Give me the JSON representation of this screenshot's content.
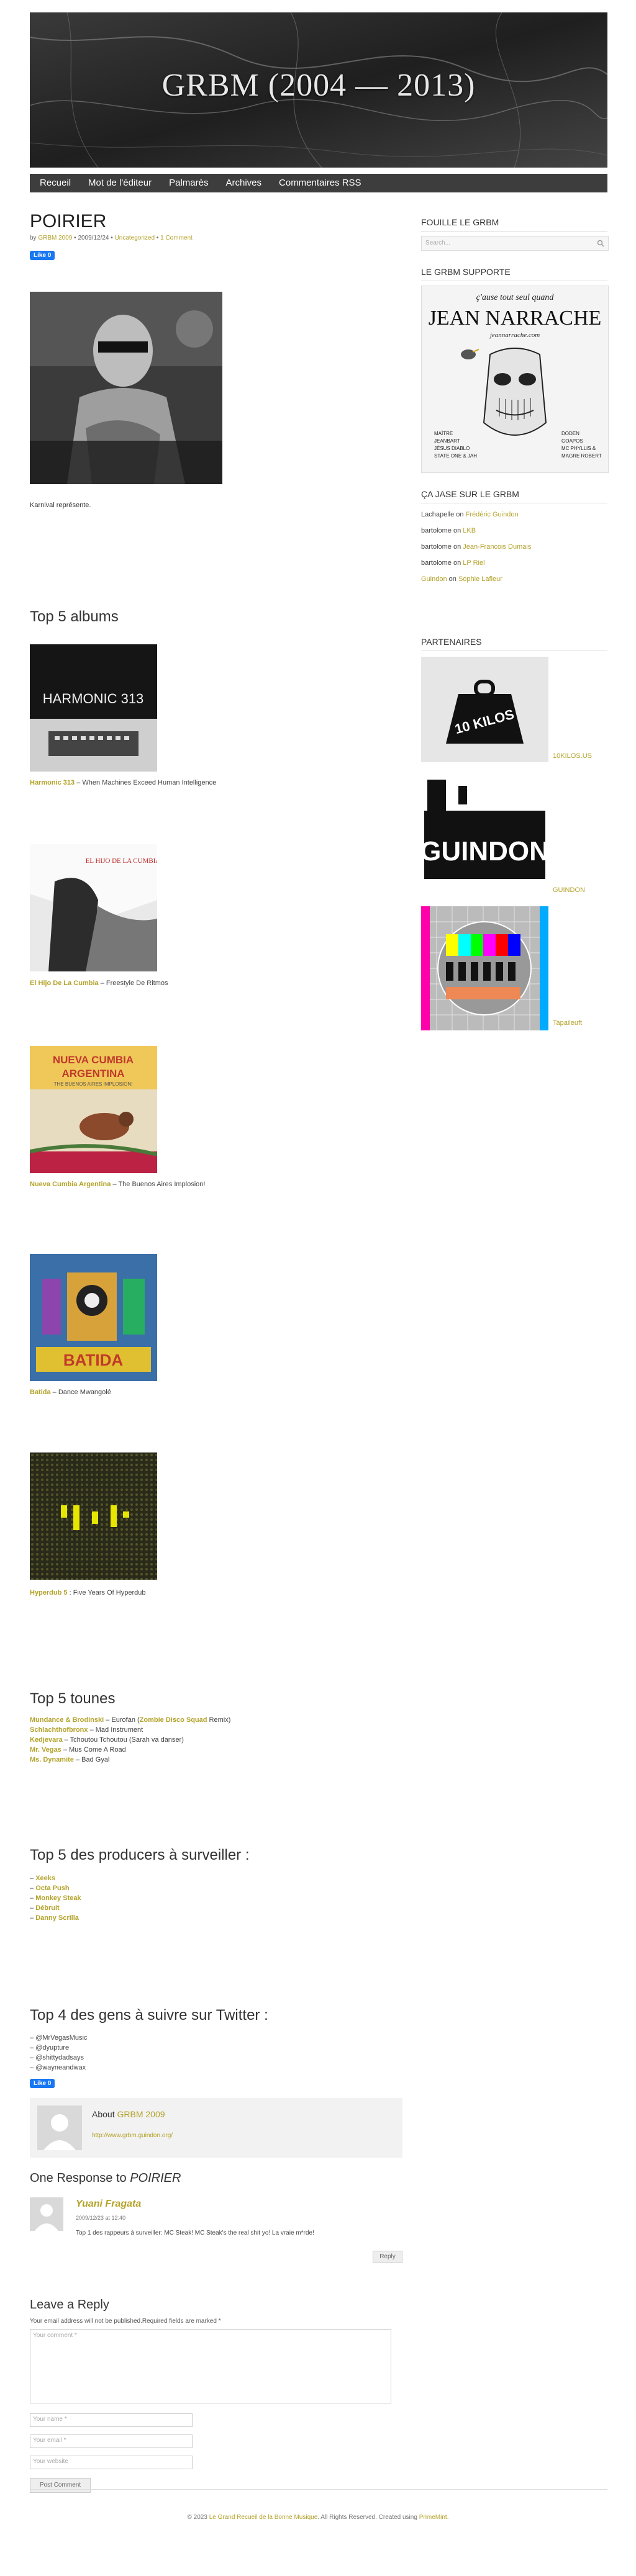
{
  "site": {
    "title": "GRBM (2004 — 2013)"
  },
  "nav": [
    "Recueil",
    "Mot de l'éditeur",
    "Palmarès",
    "Archives",
    "Commentaires RSS"
  ],
  "post": {
    "title": "POIRIER",
    "meta_by": "by",
    "meta_author": "GRBM 2009",
    "meta_date": "2009/12/24",
    "meta_category": "Uncategorized",
    "meta_comments": "1 Comment",
    "like_label": "Like 0",
    "body_text": "Karnival représente."
  },
  "albums_section": {
    "title": "Top 5 albums",
    "items": [
      {
        "artist": "Harmonic 313",
        "title": "When Machines Exceed Human Intelligence"
      },
      {
        "artist": "El Hijo De La Cumbia",
        "title": "Freestyle De Ritmos"
      },
      {
        "artist": "Nueva Cumbia Argentina",
        "title": "The Buenos Aires Implosion!"
      },
      {
        "artist": "Batida",
        "title": "Dance Mwangolé"
      },
      {
        "artist": "Hyperdub 5",
        "title": "Five Years Of Hyperdub"
      }
    ]
  },
  "tounes_section": {
    "title": "Top 5 tounes",
    "items": [
      {
        "artist": "Mundance & Brodinski",
        "title": "Eurofan (",
        "remix": "Zombie Disco Squad",
        "suffix": " Remix)"
      },
      {
        "artist": "Schlachthofbronx",
        "title": "Mad Instrument",
        "remix": "",
        "suffix": ""
      },
      {
        "artist": "Kedjevara",
        "title": "Tchoutou Tchoutou (Sarah va danser)",
        "remix": "",
        "suffix": ""
      },
      {
        "artist": "Mr. Vegas",
        "title": "Mus Come A Road",
        "remix": "",
        "suffix": ""
      },
      {
        "artist": "Ms. Dynamite",
        "title": "Bad Gyal",
        "remix": "",
        "suffix": ""
      }
    ]
  },
  "producers_section": {
    "title": "Top 5 des producers à surveiller :",
    "items": [
      "Xeeks",
      "Octa Push",
      "Monkey Steak",
      "Débruit",
      "Danny Scrilla"
    ]
  },
  "twitter_section": {
    "title": "Top 4 des gens à suivre sur Twitter :",
    "items": [
      "@MrVegasMusic",
      "@dyupture",
      "@shittydadsays",
      "@wayneandwax"
    ]
  },
  "author_box": {
    "about": "About",
    "author": "GRBM 2009",
    "url": "http://www.grbm.guindon.org/"
  },
  "comments": {
    "heading_prefix": "One Response to",
    "heading_post": "POIRIER",
    "items": [
      {
        "author": "Yuani Fragata",
        "date": "2009/12/23 at 12:40",
        "text": "Top 1 des rappeurs à surveiller: MC Steak! MC Steak's the real shit yo! La vraie m*rde!",
        "reply": "Reply"
      }
    ]
  },
  "reply_form": {
    "title": "Leave a Reply",
    "note": "Your email address will not be published.Required fields are marked *",
    "comment_placeholder": "Your comment *",
    "name_placeholder": "Your name *",
    "email_placeholder": "Your email *",
    "website_placeholder": "Your website",
    "submit": "Post Comment"
  },
  "sidebar": {
    "search_title": "FOUILLE LE GRBM",
    "search_placeholder": "Search...",
    "supporte_title": "LE GRBM SUPPORTE",
    "ad_top": "ç'ause tout seul quand",
    "ad_name": "JEAN NARRACHE",
    "ad_url": "jeannarrache.com",
    "ad_left_lines": [
      "MAÎTRE",
      "JEANBART",
      "JÉSUS DIABLO",
      "STATE ONE & JAH"
    ],
    "ad_right_lines": [
      "DODEN",
      "GOAPOS",
      "MC PHYLLIS &",
      "MAGRE ROBERT"
    ],
    "recent_title": "ÇA JASE SUR LE GRBM",
    "recent": [
      {
        "who": "Lachapelle",
        "on": "on",
        "post": "Frédéric Guindon"
      },
      {
        "who": "bartolome",
        "on": "on",
        "post": "LKB"
      },
      {
        "who": "bartolome",
        "on": "on",
        "post": "Jean-Francois Dumais"
      },
      {
        "who": "bartolome",
        "on": "on",
        "post": "LP Riel"
      },
      {
        "who": "Guindon",
        "on": "on",
        "post": "Sophie Lafleur"
      }
    ],
    "partners_title": "PARTENAIRES",
    "partners": [
      "10KILOS.US",
      "GUINDON",
      "Tapaileuft"
    ],
    "partner_logo_kilos": "10 KILOS",
    "partner_logo_guindon": "GUINDON"
  },
  "album_cover_text": {
    "harmonic": "HARMONIC 313",
    "hijo": "EL HIJO DE LA CUMBIA",
    "nueva_1": "NUEVA CUMBIA",
    "nueva_2": "ARGENTINA",
    "nueva_3": "THE BUENOS AIRES IMPLOSION!",
    "batida": "BATIDA"
  },
  "footer": {
    "copy": "© 2023",
    "site": "Le Grand Recueil de la Bonne Musique",
    "rights": ". All Rights Reserved. Created using",
    "theme": "PrimeMint."
  }
}
